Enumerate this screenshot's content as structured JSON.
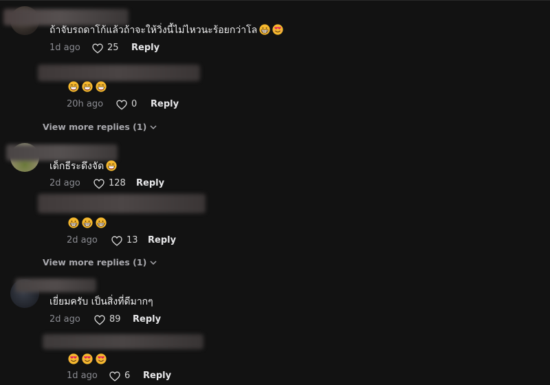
{
  "colors": {
    "background": "#121212",
    "text": "#f1f1f2",
    "muted": "#8a8b91",
    "view_more": "#a8a8ad"
  },
  "comments": [
    {
      "text": "ถ้าจับรถดาโก้แล้วถ้าจะให้วิ่งนี้ไม่ไหวนะร้อยกว่าโล",
      "emojis": [
        "grin-emoji",
        "heart-eyes-emoji"
      ],
      "time": "1d ago",
      "likes": "25",
      "reply_label": "Reply",
      "reply": {
        "emojis": [
          "beaming-emoji",
          "beaming-emoji",
          "beaming-emoji"
        ],
        "time": "20h ago",
        "likes": "0",
        "reply_label": "Reply"
      },
      "view_more": "View more replies (1)"
    },
    {
      "text": "เด็กธีระดึงจัด",
      "emojis": [
        "beaming-emoji"
      ],
      "time": "2d ago",
      "likes": "128",
      "reply_label": "Reply",
      "reply": {
        "emojis": [
          "grin-emoji",
          "grin-emoji",
          "grin-emoji"
        ],
        "time": "2d ago",
        "likes": "13",
        "reply_label": "Reply"
      },
      "view_more": "View more replies (1)"
    },
    {
      "text": "เยี่ยมครับ เป็นสิ่งที่ดีมากๆ",
      "emojis": [],
      "time": "2d ago",
      "likes": "89",
      "reply_label": "Reply",
      "reply": {
        "emojis": [
          "heart-eyes-emoji",
          "heart-eyes-emoji",
          "heart-eyes-emoji"
        ],
        "time": "1d ago",
        "likes": "6",
        "reply_label": "Reply"
      }
    }
  ]
}
